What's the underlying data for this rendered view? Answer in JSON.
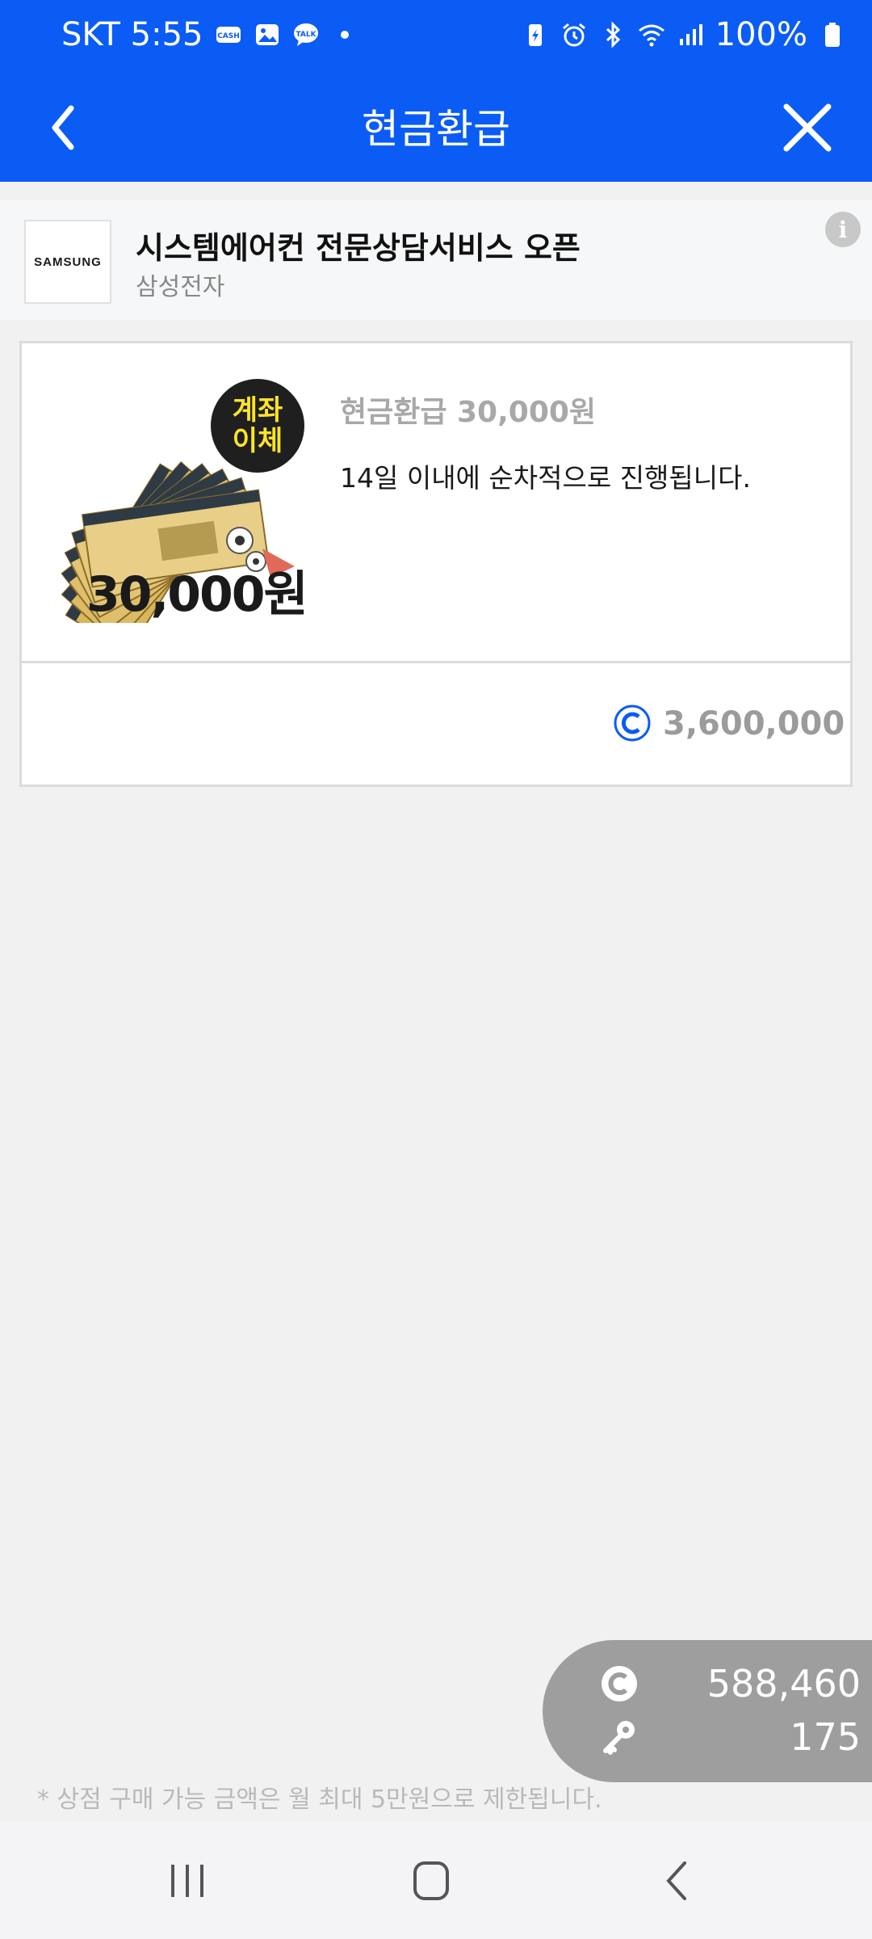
{
  "status_bar": {
    "carrier_time": "SKT 5:55",
    "battery": "100%",
    "icons_left": [
      "cash-notification-icon",
      "gallery-notification-icon",
      "talk-notification-icon",
      "dot-icon"
    ],
    "icons_right": [
      "battery-saver-icon",
      "alarm-icon",
      "bluetooth-icon",
      "wifi-icon",
      "signal-icon",
      "battery-icon"
    ]
  },
  "app_bar": {
    "title": "현금환급",
    "back_icon": "chevron-left-icon",
    "close_icon": "close-icon"
  },
  "advertiser": {
    "logo_text": "SAMSUNG",
    "title": "시스템에어컨 전문상담서비스 오픈",
    "company": "삼성전자",
    "info_icon": "i"
  },
  "product": {
    "badge_line1": "계좌",
    "badge_line2": "이체",
    "image_price": "30,000원",
    "name": "현금환급 30,000원",
    "description": "14일 이내에 순차적으로 진행됩니다.",
    "price": "3,600,000",
    "price_icon": "coin-c-icon"
  },
  "balance": {
    "coins": "588,460",
    "keys": "175",
    "coin_icon": "coin-c-icon",
    "key_icon": "key-icon"
  },
  "notice": "* 상점 구매 가능 금액은 월 최대 5만원으로 제한됩니다.",
  "nav": {
    "recents_icon": "recents-icon",
    "home_icon": "home-icon",
    "back_icon": "back-icon"
  },
  "colors": {
    "primary": "#0a5cf5",
    "badge_text": "#ffe426",
    "pill": "#9e9e9e",
    "background": "#f1f1f2"
  }
}
